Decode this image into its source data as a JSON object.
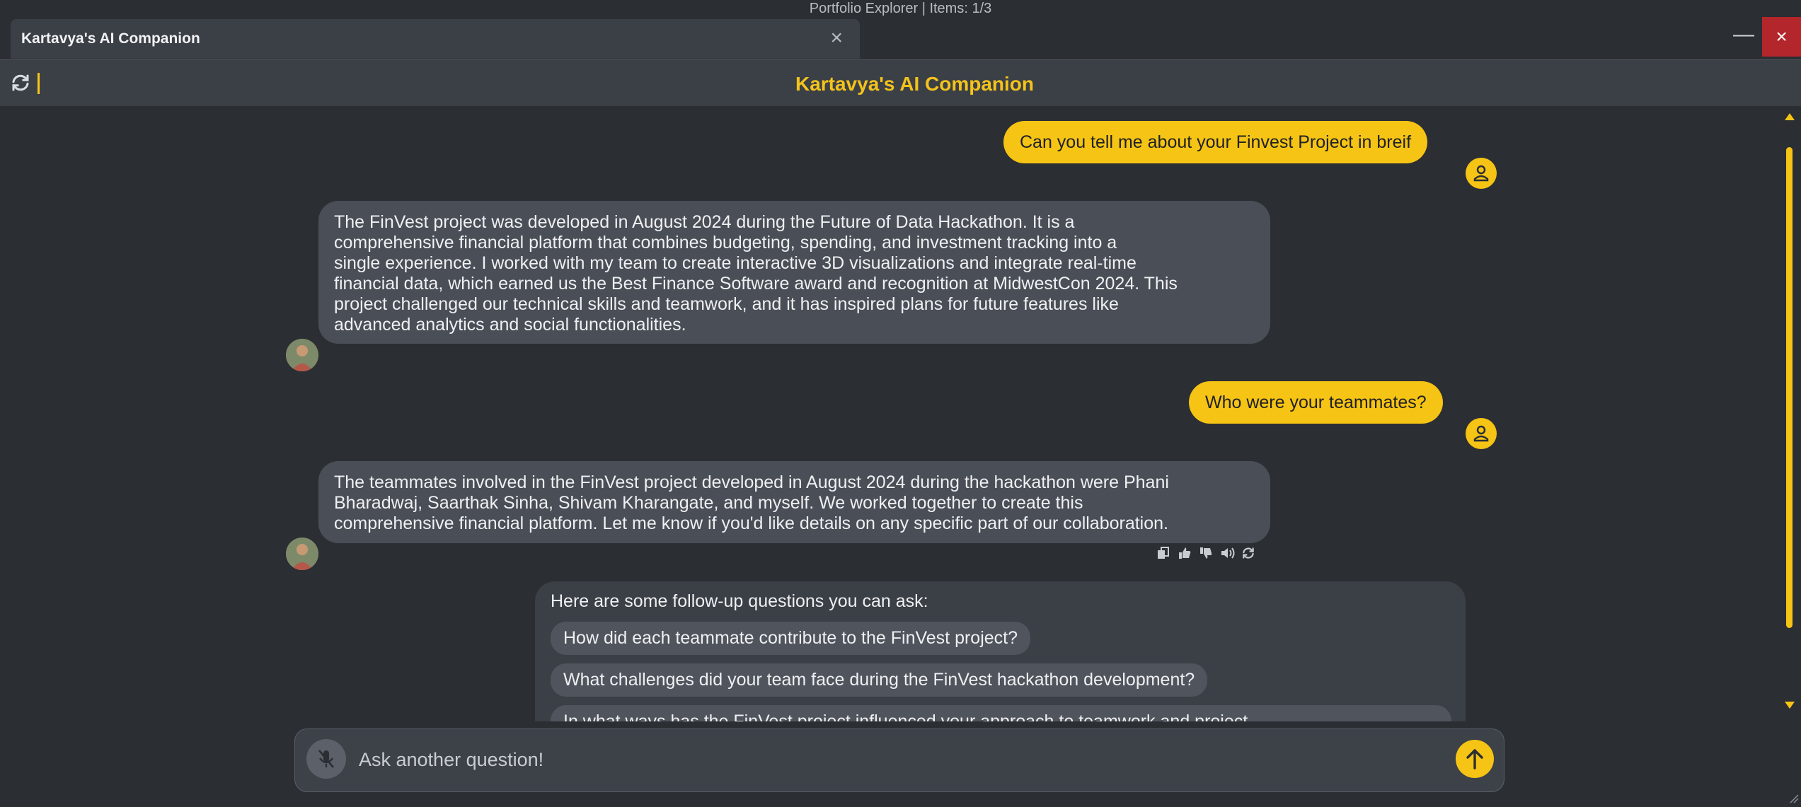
{
  "window": {
    "os_title": "Portfolio Explorer | Items: 1/3",
    "tab_title": "Kartavya's AI Companion",
    "tab_close": "×",
    "minimize": "—",
    "close": "×"
  },
  "header": {
    "title": "Kartavya's AI Companion",
    "refresh_icon": "refresh-icon"
  },
  "messages": [
    {
      "role": "user",
      "text": "Can you tell me about your Finvest Project in breif"
    },
    {
      "role": "assistant",
      "lines": [
        "The FinVest project was developed in August 2024 during the Future of Data Hackathon. It is a",
        "comprehensive financial platform that combines budgeting, spending, and investment tracking into a",
        "single experience. I worked with my team to create interactive 3D visualizations and integrate real-time",
        "financial data, which earned us the Best Finance Software award and recognition at MidwestCon 2024. This",
        "project challenged our technical skills and teamwork, and it has inspired plans for future features like",
        "advanced analytics and social functionalities."
      ]
    },
    {
      "role": "user",
      "text": "Who were your teammates?"
    },
    {
      "role": "assistant",
      "lines": [
        "The teammates involved in the FinVest project developed in August 2024 during the hackathon were Phani",
        "Bharadwaj, Saarthak Sinha, Shivam Kharangate, and myself. We worked together to create this",
        "comprehensive financial platform. Let me know if you'd like details on any specific part of our collaboration."
      ]
    }
  ],
  "message_actions": [
    "copy-icon",
    "thumbs-up-icon",
    "thumbs-down-icon",
    "speaker-icon",
    "regenerate-icon"
  ],
  "followups": {
    "title": "Here are some follow-up questions you can ask:",
    "items": [
      "How did each teammate contribute to the FinVest project?",
      "What challenges did your team face during the FinVest hackathon development?",
      "In what ways has the FinVest project influenced your approach to teamwork and project"
    ]
  },
  "input": {
    "placeholder": "Ask another question!",
    "value": ""
  },
  "colors": {
    "accent": "#f6c414",
    "background": "#2b2e33",
    "panel": "#3b3f46",
    "ai_bubble": "#4a4e56",
    "close_red": "#b3262b"
  }
}
